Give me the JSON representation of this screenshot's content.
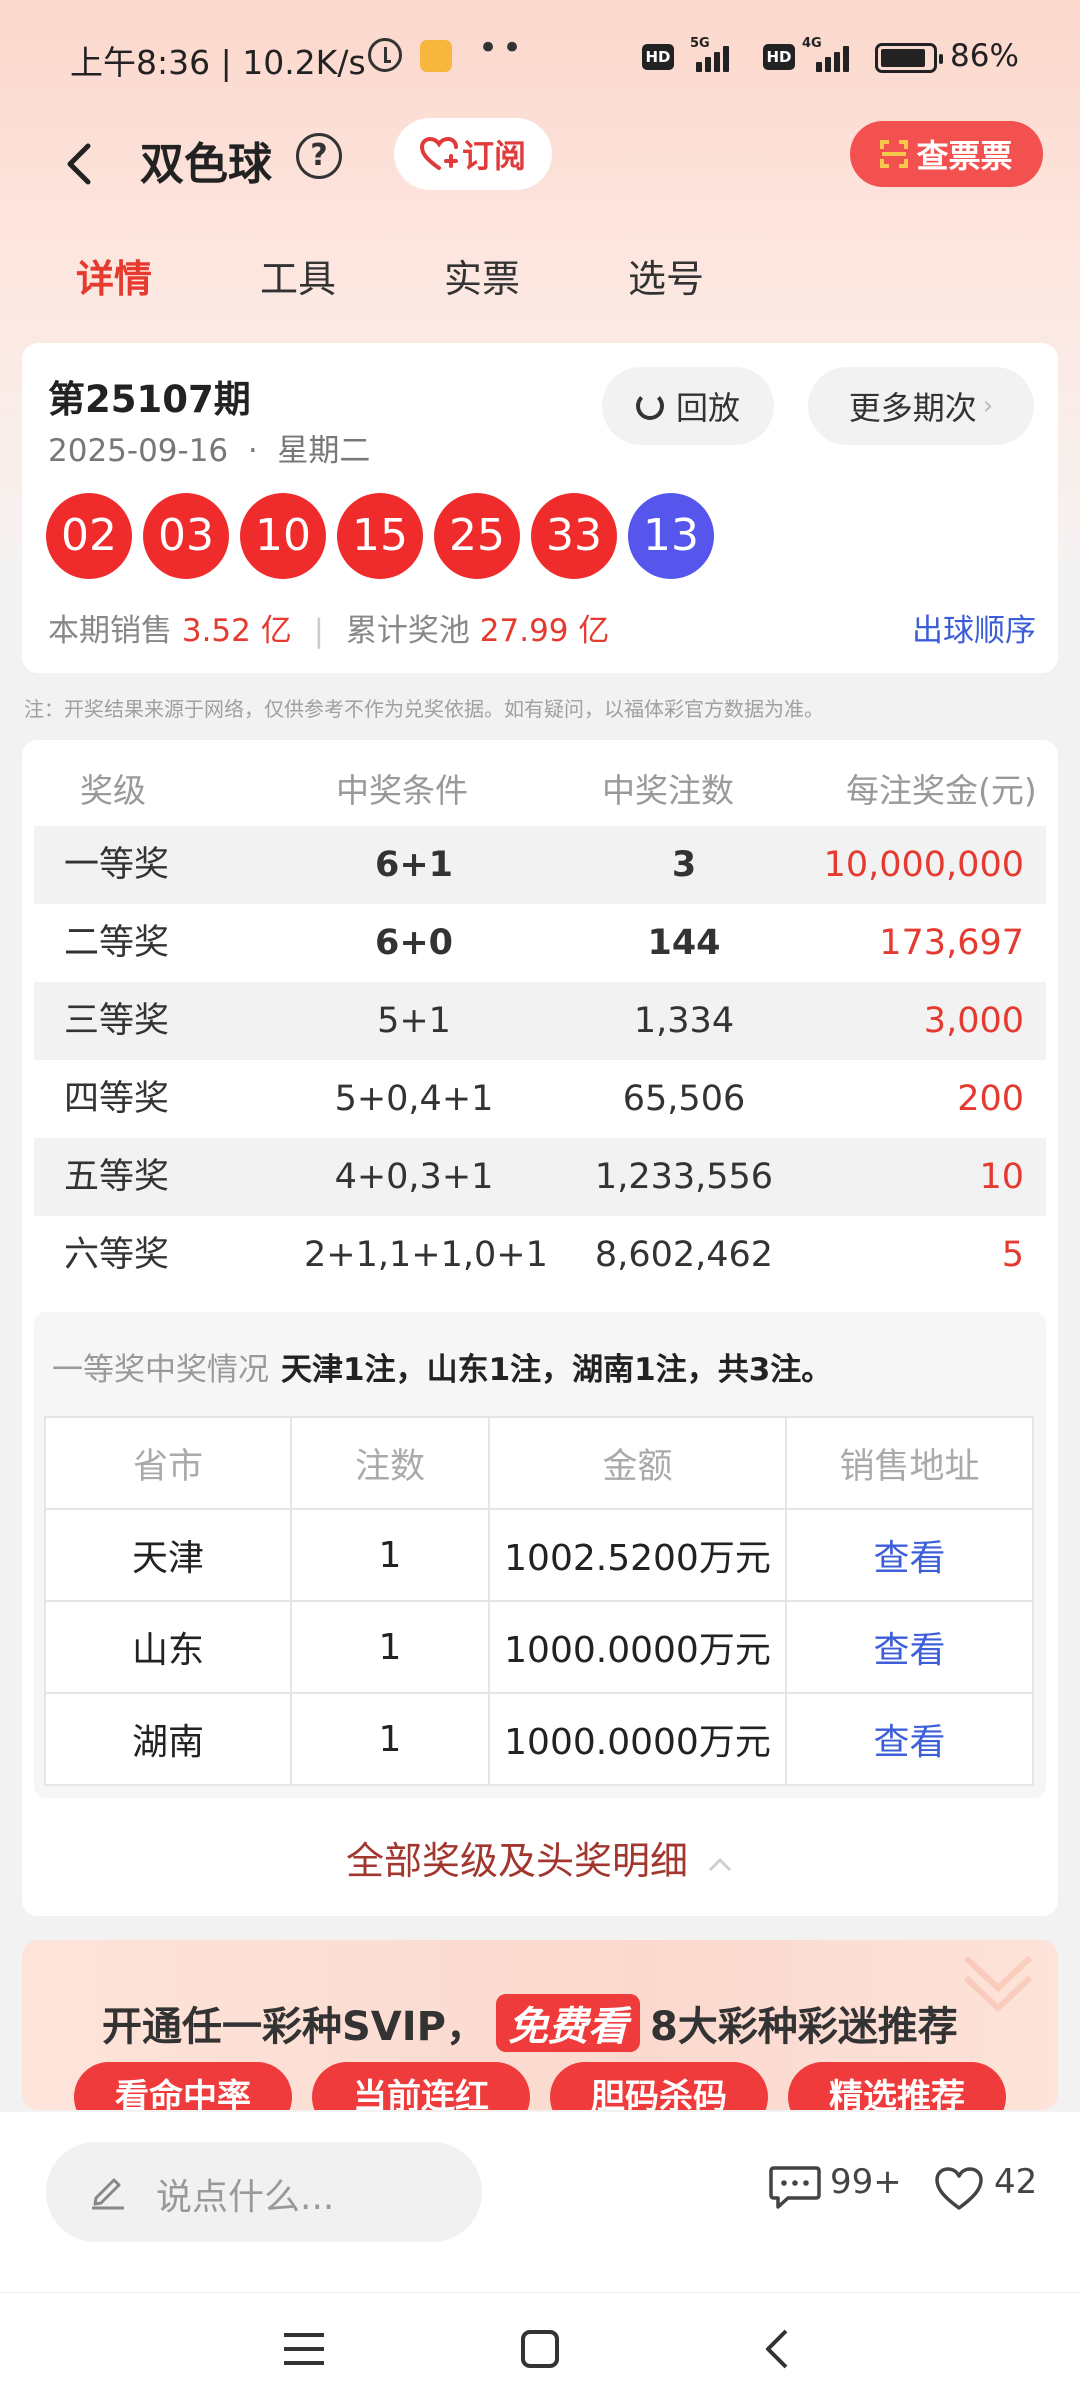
{
  "status_bar": {
    "time": "上午8:36 | 10.2K/s",
    "dots": "••",
    "hd": "HD",
    "net1": "5G",
    "net2": "4G",
    "battery": "86%"
  },
  "header": {
    "title": "双色球",
    "help": "?",
    "subscribe": "订阅",
    "check_ticket": "查票票"
  },
  "tabs": [
    {
      "label": "详情",
      "active": true
    },
    {
      "label": "工具",
      "active": false
    },
    {
      "label": "实票",
      "active": false
    },
    {
      "label": "选号",
      "active": false
    }
  ],
  "draw": {
    "issue": "第25107期",
    "date": "2025-09-16  ·  星期二",
    "replay": "回放",
    "more": "更多期次",
    "red_balls": [
      "02",
      "03",
      "10",
      "15",
      "25",
      "33"
    ],
    "blue_ball": "13",
    "sales_label": "本期销售",
    "sales_value": "3.52 亿",
    "pool_label": "累计奖池",
    "pool_value": "27.99 亿",
    "order_link": "出球顺序"
  },
  "note": "注：开奖结果来源于网络，仅供参考不作为兑奖依据。如有疑问，以福体彩官方数据为准。",
  "prize_table": {
    "headers": [
      "奖级",
      "中奖条件",
      "中奖注数",
      "每注奖金(元)"
    ],
    "rows": [
      [
        "一等奖",
        "6+1",
        "3",
        "10,000,000"
      ],
      [
        "二等奖",
        "6+0",
        "144",
        "173,697"
      ],
      [
        "三等奖",
        "5+1",
        "1,334",
        "3,000"
      ],
      [
        "四等奖",
        "5+0,4+1",
        "65,506",
        "200"
      ],
      [
        "五等奖",
        "4+0,3+1",
        "1,233,556",
        "10"
      ],
      [
        "六等奖",
        "2+1,1+1,0+1",
        "8,602,462",
        "5"
      ]
    ]
  },
  "first_prize": {
    "summary_label": "一等奖中奖情况",
    "summary_text": "天津1注，山东1注，湖南1注，共3注。",
    "headers": [
      "省市",
      "注数",
      "金额",
      "销售地址"
    ],
    "rows": [
      [
        "天津",
        "1",
        "1002.5200万元",
        "查看"
      ],
      [
        "山东",
        "1",
        "1000.0000万元",
        "查看"
      ],
      [
        "湖南",
        "1",
        "1000.0000万元",
        "查看"
      ]
    ],
    "all_link": "全部奖级及头奖明细"
  },
  "banner": {
    "text_a": "开通任一彩种SVIP，",
    "free": "免费看",
    "text_b": "8大彩种彩迷推荐",
    "pills": [
      "看命中率",
      "当前连红",
      "胆码杀码",
      "精选推荐"
    ]
  },
  "bottom": {
    "comment_placeholder": "说点什么...",
    "comments": "99+",
    "likes": "42"
  }
}
